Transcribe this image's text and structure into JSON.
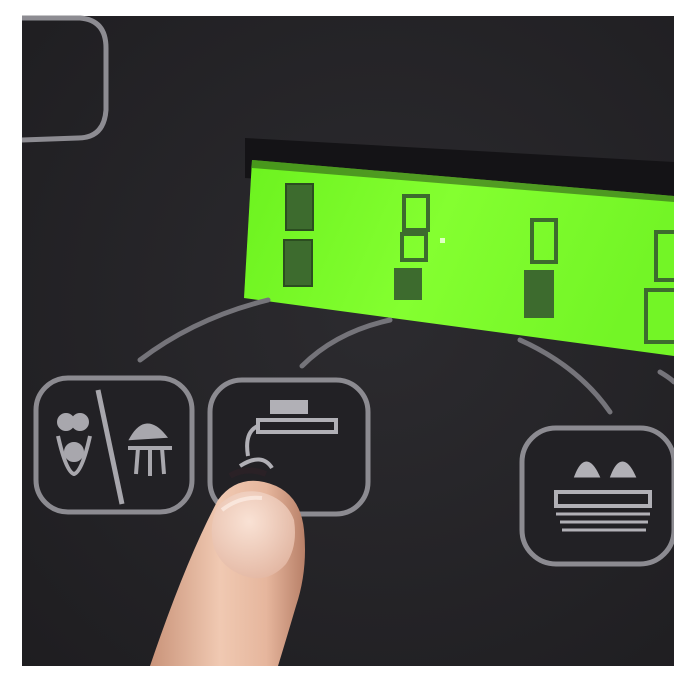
{
  "photo": {
    "subject": "control-panel-closeup",
    "panel_color": "#262528",
    "lcd_color": "#7dff2a",
    "lcd_segment_color": "#3d6b2e"
  },
  "lcd": {
    "digits": [
      {
        "top": "full",
        "bottom": "full"
      },
      {
        "top": "empty",
        "bottom": "partial"
      },
      {
        "top": "empty",
        "bottom": "full"
      },
      {
        "top": "empty",
        "bottom": "empty"
      }
    ]
  },
  "buttons": [
    {
      "icon": "massage-toggle-icon"
    },
    {
      "icon": "foot-pedal-icon"
    },
    {
      "icon": "heated-seat-icon"
    }
  ]
}
